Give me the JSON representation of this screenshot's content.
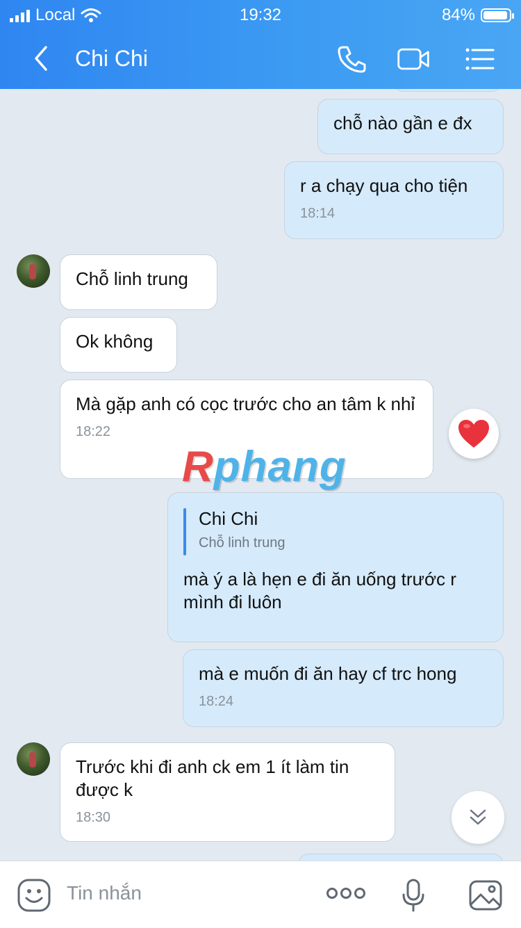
{
  "status_bar": {
    "carrier": "Local",
    "time": "19:32",
    "battery_percent": "84%",
    "battery_level": 0.84,
    "icons": [
      "signal-icon",
      "wifi-icon",
      "battery-icon"
    ]
  },
  "header": {
    "title": "Chi Chi",
    "icons": [
      "back-chevron-icon",
      "phone-icon",
      "video-call-icon",
      "menu-list-icon"
    ],
    "colors": {
      "start": "#2f86f1",
      "end": "#4aa6f4"
    }
  },
  "messages": [
    {
      "dir": "out",
      "text": "chỗ nào gần e đx"
    },
    {
      "dir": "out",
      "text": "r a chạy qua cho tiện",
      "time": "18:14"
    },
    {
      "dir": "in",
      "text": "Chỗ linh trung"
    },
    {
      "dir": "in",
      "text": "Ok không"
    },
    {
      "dir": "in",
      "text": "Mà gặp anh có cọc trước cho an tâm k nhỉ",
      "time": "18:22",
      "reaction": "heart-icon"
    },
    {
      "dir": "out",
      "quote_name": "Chi Chi",
      "quote_text": "Chỗ linh trung",
      "text": "mà ý a là hẹn e đi ăn uống trước r mình đi luôn"
    },
    {
      "dir": "out",
      "text": "mà e muốn đi ăn hay cf trc hong",
      "time": "18:24"
    },
    {
      "dir": "in",
      "text": "Trước khi đi anh ck em 1 ít làm tin được k",
      "time": "18:30"
    }
  ],
  "watermark": {
    "prefix": "R",
    "rest": "phang"
  },
  "composer": {
    "placeholder": "Tin nhắn",
    "icons": [
      "emoji-icon",
      "more-dots-icon",
      "microphone-icon",
      "image-icon"
    ]
  },
  "colors": {
    "background": "#e2e9f1",
    "outgoing_bubble": "#d5eafb",
    "incoming_bubble": "#ffffff",
    "heart": "#e8323c"
  }
}
